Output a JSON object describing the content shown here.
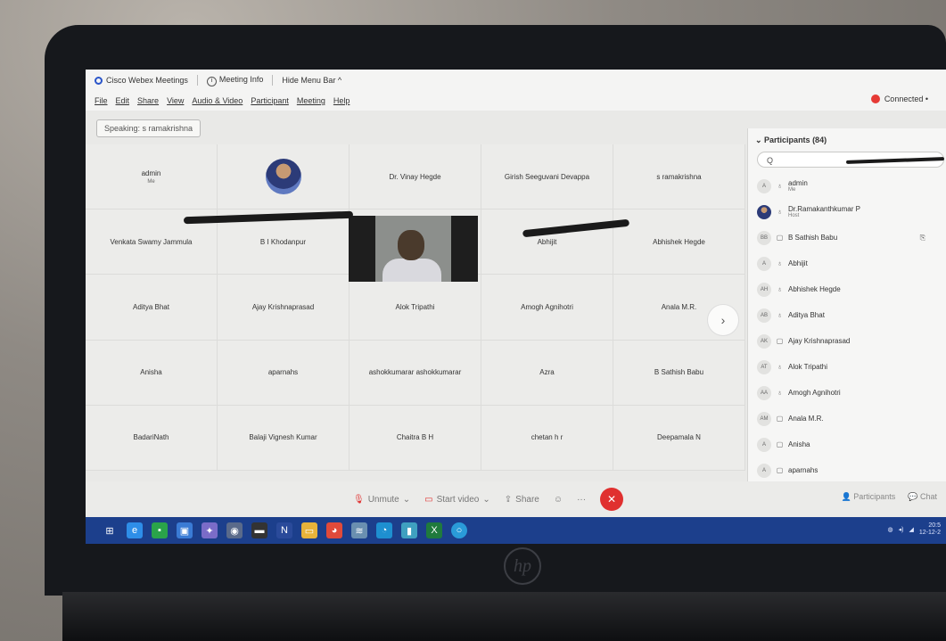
{
  "titlebar": {
    "app_name": "Cisco Webex Meetings",
    "meeting_info": "Meeting Info",
    "hide_menu": "Hide Menu Bar ^"
  },
  "menu": [
    "File",
    "Edit",
    "Share",
    "View",
    "Audio & Video",
    "Participant",
    "Meeting",
    "Help"
  ],
  "status": {
    "connected": "Connected •"
  },
  "speaking": "Speaking: s ramakrishna",
  "grid_tiles": [
    {
      "name": "admin",
      "sub": "Me"
    },
    {
      "name": "",
      "sub": "",
      "photo": true
    },
    {
      "name": "Dr. Vinay Hegde"
    },
    {
      "name": "Girish Seeguvani Devappa"
    },
    {
      "name": "s ramakrishna"
    },
    {
      "name": "Venkata Swamy Jammula"
    },
    {
      "name": "B I Khodanpur"
    },
    {
      "name": "",
      "video": true
    },
    {
      "name": "Abhijit"
    },
    {
      "name": "Abhishek Hegde"
    },
    {
      "name": "Aditya Bhat"
    },
    {
      "name": "Ajay Krishnaprasad"
    },
    {
      "name": "Alok Tripathi"
    },
    {
      "name": "Amogh Agnihotri"
    },
    {
      "name": "Anala M.R."
    },
    {
      "name": "Anisha"
    },
    {
      "name": "aparnahs"
    },
    {
      "name": "ashokkumarar ashokkumarar"
    },
    {
      "name": "Azra"
    },
    {
      "name": "B Sathish Babu"
    },
    {
      "name": "BadariNath"
    },
    {
      "name": "Balaji Vignesh Kumar"
    },
    {
      "name": "Chaitra B H"
    },
    {
      "name": "chetan h r"
    },
    {
      "name": "Deepamala N"
    }
  ],
  "participants": {
    "title": "Participants (84)",
    "search_placeholder": "Q",
    "items": [
      {
        "initials": "A",
        "name": "admin",
        "role": "Me",
        "mic": "mic"
      },
      {
        "initials": "",
        "name": "Dr.Ramakanthkumar P",
        "role": "Host",
        "mic": "mic",
        "photo": true
      },
      {
        "initials": "BB",
        "name": "B Sathish Babu",
        "role": "",
        "mic": "screen",
        "sharing": "⎘"
      },
      {
        "initials": "A",
        "name": "Abhijit",
        "role": "",
        "mic": "mic"
      },
      {
        "initials": "AH",
        "name": "Abhishek Hegde",
        "role": "",
        "mic": "mic"
      },
      {
        "initials": "AB",
        "name": "Aditya Bhat",
        "role": "",
        "mic": "mic"
      },
      {
        "initials": "AK",
        "name": "Ajay Krishnaprasad",
        "role": "",
        "mic": "screen"
      },
      {
        "initials": "AT",
        "name": "Alok Tripathi",
        "role": "",
        "mic": "mic"
      },
      {
        "initials": "AA",
        "name": "Amogh Agnihotri",
        "role": "",
        "mic": "mic"
      },
      {
        "initials": "AM",
        "name": "Anala M.R.",
        "role": "",
        "mic": "screen"
      },
      {
        "initials": "A",
        "name": "Anisha",
        "role": "",
        "mic": "screen"
      },
      {
        "initials": "A",
        "name": "aparnahs",
        "role": "",
        "mic": "screen"
      }
    ]
  },
  "controls": {
    "unmute": "Unmute",
    "start_video": "Start video",
    "share": "Share",
    "more": "···",
    "end": "✕",
    "participants_btn": "Participants",
    "chat_btn": "Chat"
  },
  "taskbar": {
    "clock_time": "20:5",
    "clock_date": "12-12-2"
  },
  "colors": {
    "end_call": "#e0302f",
    "taskbar": "#1c3f8c",
    "connected_dot": "#e63a35"
  }
}
